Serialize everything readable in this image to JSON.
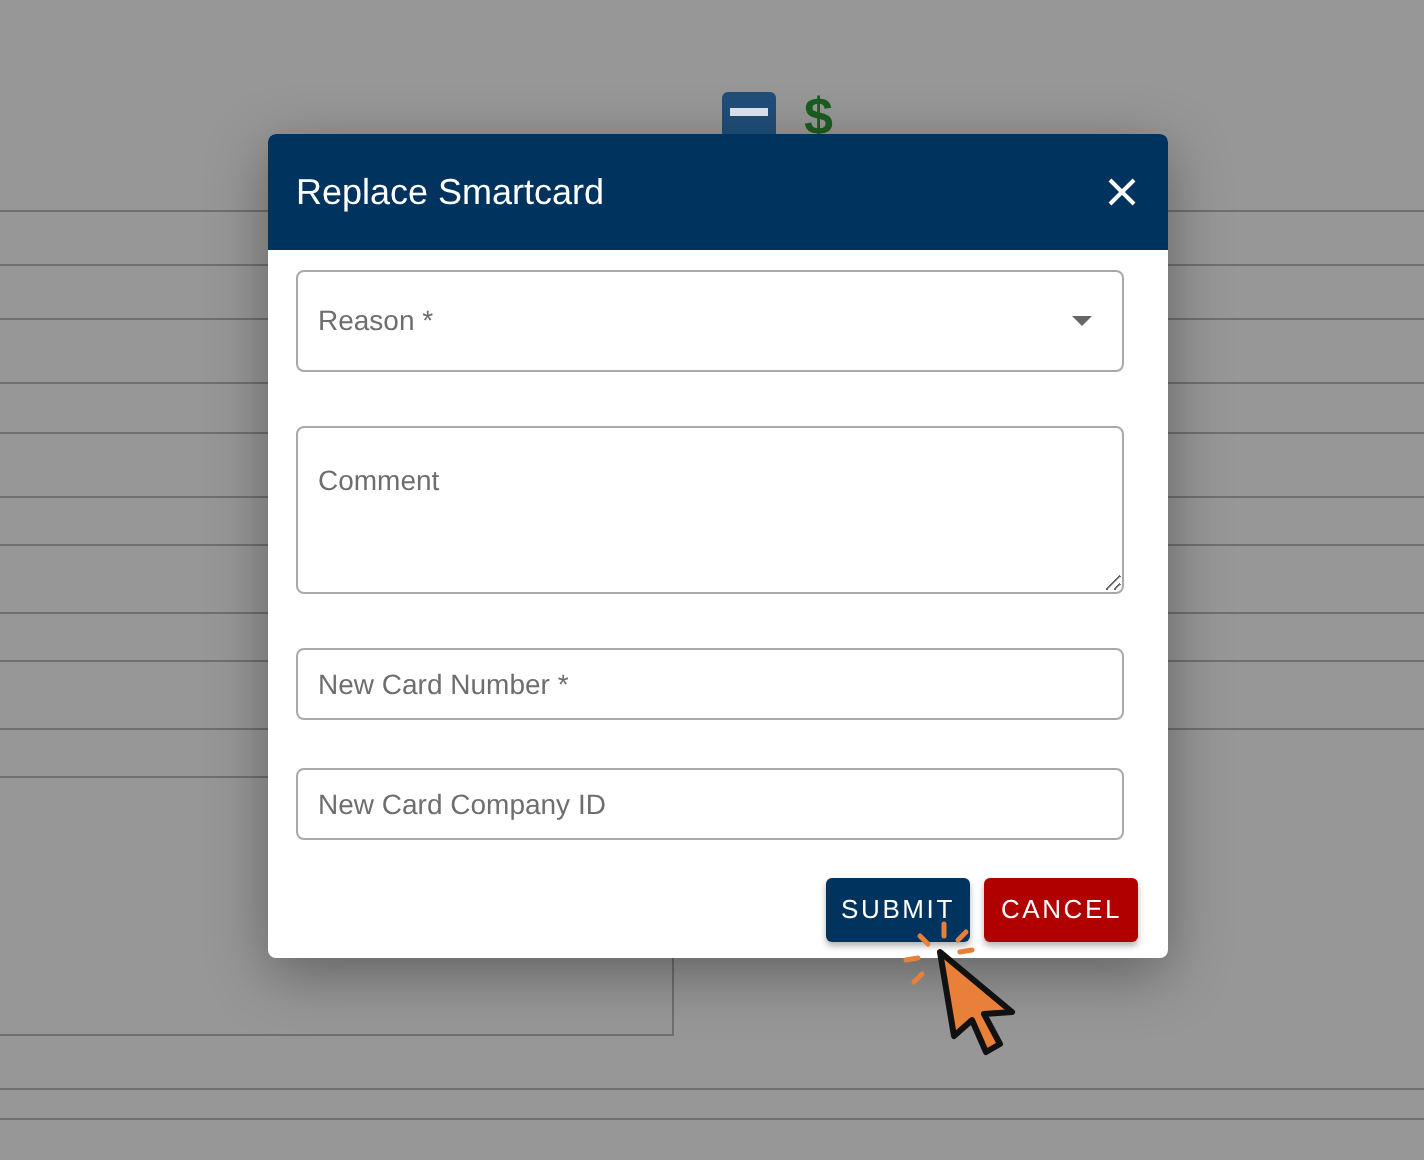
{
  "background": {
    "currency_symbol": "$"
  },
  "modal": {
    "title": "Replace Smartcard",
    "fields": [
      {
        "kind": "select",
        "placeholder": "Reason *"
      },
      {
        "kind": "textarea",
        "placeholder": "Comment"
      },
      {
        "kind": "input",
        "placeholder": "New Card Number *"
      },
      {
        "kind": "input",
        "placeholder": "New Card Company ID"
      }
    ],
    "buttons": [
      {
        "label": "SUBMIT",
        "kind": "primary"
      },
      {
        "label": "CANCEL",
        "kind": "danger"
      }
    ]
  }
}
